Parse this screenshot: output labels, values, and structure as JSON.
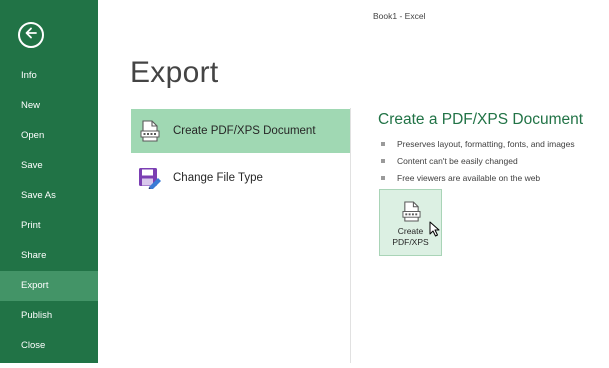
{
  "window": {
    "title": "Book1 - Excel"
  },
  "sidebar": {
    "back_icon": "arrow-left-circle-icon",
    "items": [
      {
        "label": "Info"
      },
      {
        "label": "New"
      },
      {
        "label": "Open"
      },
      {
        "label": "Save"
      },
      {
        "label": "Save As"
      },
      {
        "label": "Print"
      },
      {
        "label": "Share"
      },
      {
        "label": "Export",
        "active": true
      },
      {
        "label": "Publish"
      },
      {
        "label": "Close"
      }
    ]
  },
  "main": {
    "title": "Export",
    "options": [
      {
        "label": "Create PDF/XPS Document",
        "icon": "pdf-document-icon",
        "active": true
      },
      {
        "label": "Change File Type",
        "icon": "save-as-type-icon"
      }
    ],
    "detail": {
      "title": "Create a PDF/XPS Document",
      "bullets": [
        "Preserves layout, formatting, fonts, and images",
        "Content can't be easily changed",
        "Free viewers are available on the web"
      ],
      "button_label": "Create\nPDF/XPS",
      "button_icon": "pdf-document-icon"
    }
  },
  "colors": {
    "sidebar_bg": "#217346",
    "sidebar_active": "#439467",
    "option_active": "#a0d8b3",
    "accent_text": "#217346"
  }
}
